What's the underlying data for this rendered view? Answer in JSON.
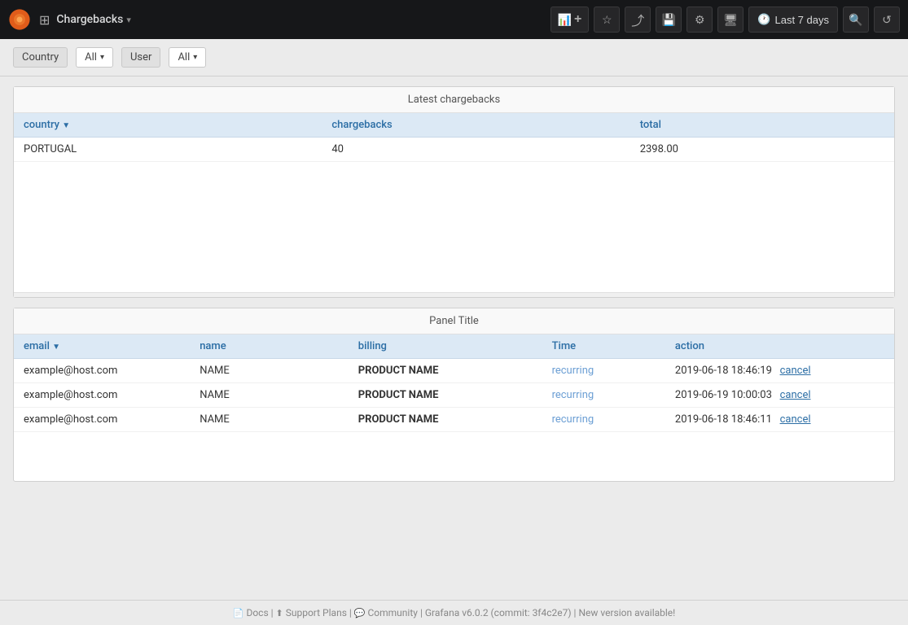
{
  "topnav": {
    "logo_title": "Grafana",
    "app_title": "Chargebacks",
    "dropdown_arrow": "▾",
    "buttons": [
      {
        "name": "add-panel-btn",
        "icon": "📊",
        "label": "+"
      },
      {
        "name": "star-btn",
        "icon": "★"
      },
      {
        "name": "share-btn",
        "icon": "↗"
      },
      {
        "name": "save-btn",
        "icon": "💾"
      },
      {
        "name": "settings-btn",
        "icon": "⚙"
      },
      {
        "name": "display-btn",
        "icon": "🖥"
      },
      {
        "name": "time-range-btn",
        "label": "Last 7 days",
        "icon": "🕐"
      },
      {
        "name": "search-btn",
        "icon": "🔍"
      },
      {
        "name": "refresh-btn",
        "icon": "↺"
      }
    ]
  },
  "filterbar": {
    "country_label": "Country",
    "country_value": "All",
    "user_label": "User",
    "user_value": "All"
  },
  "panel1": {
    "title": "Latest chargebacks",
    "columns": [
      {
        "key": "country",
        "label": "country",
        "sortable": true
      },
      {
        "key": "chargebacks",
        "label": "chargebacks",
        "sortable": false
      },
      {
        "key": "total",
        "label": "total",
        "sortable": false
      }
    ],
    "rows": [
      {
        "country": "PORTUGAL",
        "chargebacks": "40",
        "total": "2398.00"
      }
    ]
  },
  "panel2": {
    "title": "Panel Title",
    "columns": [
      {
        "key": "email",
        "label": "email",
        "sortable": true
      },
      {
        "key": "name",
        "label": "name",
        "sortable": false
      },
      {
        "key": "billing",
        "label": "billing",
        "sortable": false
      },
      {
        "key": "time",
        "label": "Time",
        "sortable": false
      },
      {
        "key": "action",
        "label": "action",
        "sortable": false
      }
    ],
    "rows": [
      {
        "email": "example@host.com",
        "name": "NAME",
        "billing": "PRODUCT NAME",
        "time": "recurring",
        "timestamp": "2019-06-18 18:46:19",
        "action": "cancel"
      },
      {
        "email": "example@host.com",
        "name": "NAME",
        "billing": "PRODUCT NAME",
        "time": "recurring",
        "timestamp": "2019-06-19 10:00:03",
        "action": "cancel"
      },
      {
        "email": "example@host.com",
        "name": "NAME",
        "billing": "PRODUCT NAME",
        "time": "recurring",
        "timestamp": "2019-06-18 18:46:11",
        "action": "cancel"
      }
    ]
  },
  "footer": {
    "docs_label": "Docs",
    "support_label": "Support Plans",
    "community_label": "Community",
    "version_text": "Grafana v6.0.2 (commit: 3f4c2e7)",
    "new_version_text": "New version available!",
    "separator": "|"
  }
}
